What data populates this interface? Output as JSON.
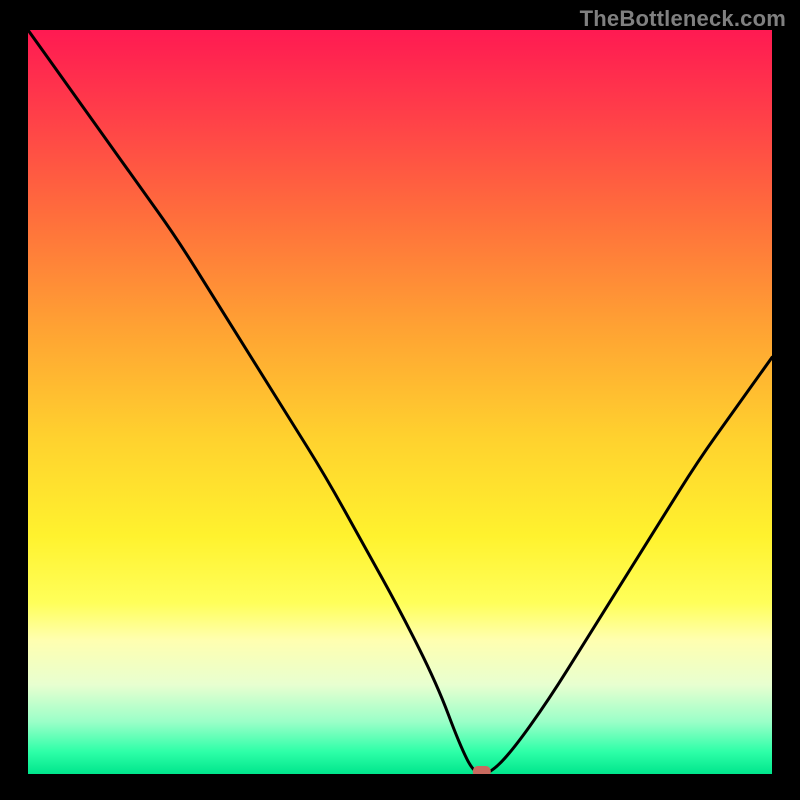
{
  "watermark": "TheBottleneck.com",
  "chart_data": {
    "type": "line",
    "title": "",
    "xlabel": "",
    "ylabel": "",
    "xlim": [
      0,
      100
    ],
    "ylim": [
      0,
      100
    ],
    "series": [
      {
        "name": "bottleneck-curve",
        "x": [
          0,
          5,
          10,
          15,
          20,
          25,
          30,
          35,
          40,
          45,
          50,
          55,
          58,
          60,
          62,
          65,
          70,
          75,
          80,
          85,
          90,
          95,
          100
        ],
        "y": [
          100,
          93,
          86,
          79,
          72,
          64,
          56,
          48,
          40,
          31,
          22,
          12,
          4,
          0,
          0,
          3,
          10,
          18,
          26,
          34,
          42,
          49,
          56
        ]
      }
    ],
    "marker": {
      "x": 61,
      "y": 0,
      "color": "#c96a5f"
    },
    "background_gradient": {
      "top": "#ff1a52",
      "mid": "#ffe02e",
      "bottom": "#00e68c"
    }
  }
}
